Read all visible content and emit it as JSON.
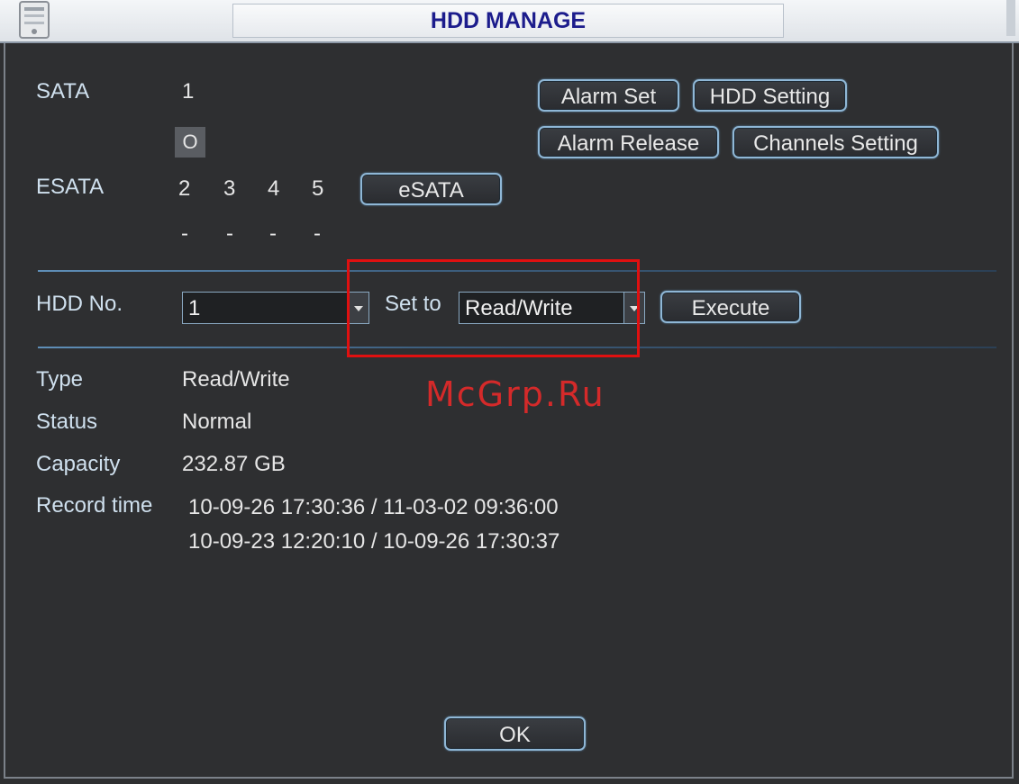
{
  "window": {
    "title": "HDD MANAGE"
  },
  "sata": {
    "label": "SATA",
    "port": "1",
    "indicator": "O"
  },
  "esata": {
    "label": "ESATA",
    "ports": [
      "2",
      "3",
      "4",
      "5"
    ],
    "states": [
      "-",
      "-",
      "-",
      "-"
    ],
    "button": "eSATA"
  },
  "buttons": {
    "alarm_set": "Alarm Set",
    "hdd_setting": "HDD Setting",
    "alarm_release": "Alarm Release",
    "channels_setting": "Channels Setting",
    "execute": "Execute",
    "ok": "OK"
  },
  "hdd_control": {
    "hdd_no_label": "HDD No.",
    "hdd_no_value": "1",
    "set_to_label": "Set to",
    "set_to_value": "Read/Write"
  },
  "info": {
    "type_label": "Type",
    "type_value": "Read/Write",
    "status_label": "Status",
    "status_value": "Normal",
    "capacity_label": "Capacity",
    "capacity_value": "232.87 GB",
    "record_label": "Record time",
    "record_values": [
      "10-09-26 17:30:36 / 11-03-02 09:36:00",
      "10-09-23 12:20:10 / 10-09-26 17:30:37"
    ]
  },
  "watermark": "McGrp.Ru",
  "colors": {
    "highlight": "#e01010",
    "watermark": "#d42a2a",
    "title_text": "#1c1c8c"
  }
}
